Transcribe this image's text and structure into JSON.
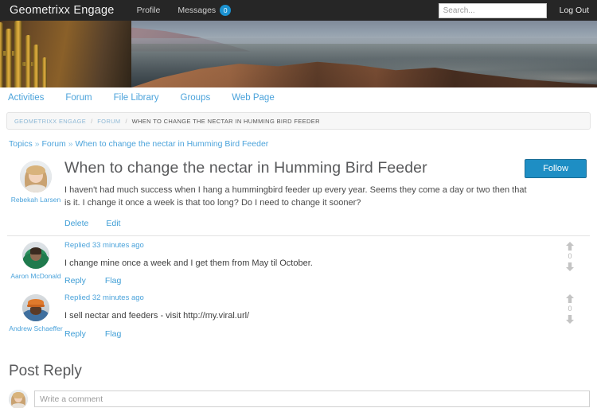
{
  "topbar": {
    "brand": "Geometrixx Engage",
    "nav": [
      {
        "label": "Profile"
      },
      {
        "label": "Messages",
        "badge": "0"
      }
    ],
    "search_placeholder": "Search...",
    "logout_label": "Log Out"
  },
  "mainnav": {
    "items": [
      {
        "label": "Activities"
      },
      {
        "label": "Forum"
      },
      {
        "label": "File Library"
      },
      {
        "label": "Groups"
      },
      {
        "label": "Web Page"
      }
    ]
  },
  "breadcrumb": {
    "items": [
      {
        "label": "GEOMETRIXX ENGAGE"
      },
      {
        "label": "FORUM"
      },
      {
        "label": "WHEN TO CHANGE THE NECTAR IN HUMMING BIRD FEEDER"
      }
    ],
    "separator": "/"
  },
  "topicpath": {
    "root": "Topics",
    "sep": "»",
    "section": "Forum",
    "current": "When to change the nectar in Humming Bird Feeder"
  },
  "topic": {
    "author": "Rebekah Larsen",
    "title": "When to change the nectar in Humming Bird Feeder",
    "body": "I haven't had much success when I hang a hummingbird feeder up every year. Seems they come a day or two then that is it. I change it once a week is that too long? Do I need to change it sooner?",
    "follow_label": "Follow",
    "actions": [
      {
        "label": "Delete"
      },
      {
        "label": "Edit"
      }
    ]
  },
  "replies": [
    {
      "author": "Aaron McDonald",
      "meta": "Replied 33 minutes ago",
      "text": "I change mine once a week and I get them from May til October.",
      "actions": [
        {
          "label": "Reply"
        },
        {
          "label": "Flag"
        }
      ],
      "vote_count": "0"
    },
    {
      "author": "Andrew Schaeffer",
      "meta": "Replied 32 minutes ago",
      "text": "I sell nectar and feeders - visit http://my.viral.url/",
      "actions": [
        {
          "label": "Reply"
        },
        {
          "label": "Flag"
        }
      ],
      "vote_count": "0"
    }
  ],
  "postreply": {
    "heading": "Post Reply",
    "placeholder": "Write a comment"
  },
  "colors": {
    "topbar_bg": "#262626",
    "link_blue": "#4ba3db",
    "accent_blue": "#1e8ec4",
    "badge_blue": "#1b92d1",
    "text_dark": "#58595b"
  }
}
